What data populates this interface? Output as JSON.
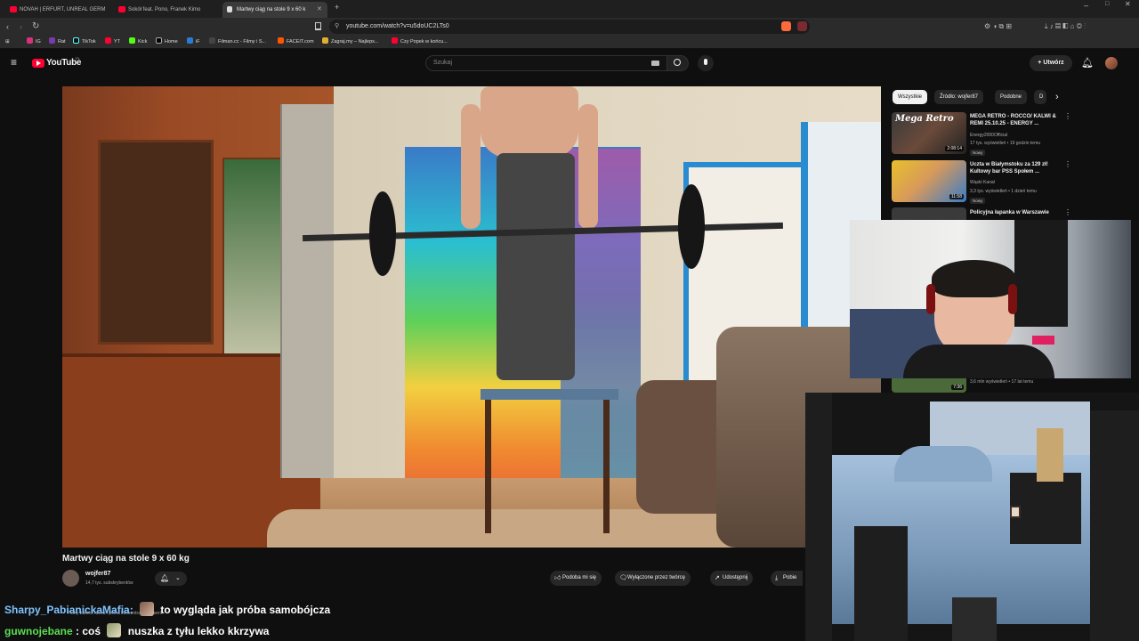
{
  "browser": {
    "tabs": [
      {
        "title": "NOVAH | ERFURT, UNREAL GERM"
      },
      {
        "title": "Sokół feat. Pono, Franek Kimo"
      },
      {
        "title": "Martwy ciąg na stole 9 x 60 k"
      }
    ],
    "url": "youtube.com/watch?v=u5doUC2LTs0",
    "bookmarks": [
      "IG",
      "Rat",
      "TikTok",
      "YT",
      "Kick",
      "Home",
      "iF",
      "Filman.cc - Filmy i S...",
      "FACEIT.com",
      "Zagraj.my – Najleps...",
      "Czy Popek w końcu..."
    ]
  },
  "youtube": {
    "logo": "YouTube",
    "logo_region": "PL",
    "search_placeholder": "Szukaj",
    "create_label": "Utwórz"
  },
  "video": {
    "title": "Martwy ciąg na stole 9 x 60 kg",
    "channel": "wojfer87",
    "subscribers": "14,7 tys. subskrybentów",
    "actions": {
      "like": "Podoba mi się",
      "creator": "Wyłączone przez twórcę",
      "share": "Udostępnij",
      "download": "Pobie"
    }
  },
  "sidebar": {
    "chips": [
      "Wszystkie",
      "Źródło: wojfer87",
      "Podobne",
      "D"
    ],
    "videos": [
      {
        "title": "MEGA RETRO - ROCCO/ KALWI & REMI 25.10.25 - ENERGY ...",
        "channel": "Energy2000Official",
        "meta": "17 tys. wyświetleń • 19 godzin temu",
        "badge": "Nowy",
        "duration": "2:08:14",
        "thumb_text": "Mega Retro"
      },
      {
        "title": "Uczta w Białymstoku za 129 zł! Kultowy bar PSS Społem ...",
        "channel": "Wąski Kanał",
        "meta": "3,3 tys. wyświetleń • 1 dzień temu",
        "badge": "Nowy",
        "duration": "11:58"
      },
      {
        "title": "Policyjna łapanka w Warszawie",
        "channel": "",
        "meta": ""
      },
      {
        "title": "",
        "channel": "",
        "meta": "3,6 mln wyświetleń • 17 lat temu",
        "duration": "7:36"
      }
    ]
  },
  "chat": [
    {
      "user": "Sharpy_PabianickaMafia",
      "separator": ":",
      "message": "to wygląda jak próba samobójcza"
    },
    {
      "user": "guwnojebane",
      "separator": ":",
      "message_prefix": "coś",
      "message": "nuszka z tyłu lekko kkrzywa"
    }
  ],
  "subtitle_fragment": "Pełny zakres ruchu i pełna koncentracja na serii",
  "colors": {
    "yt_red": "#ff0033",
    "bg": "#0f0f0f",
    "chip": "#272727",
    "chat_user1": "#7fc4ff",
    "chat_user2": "#5cde55"
  }
}
